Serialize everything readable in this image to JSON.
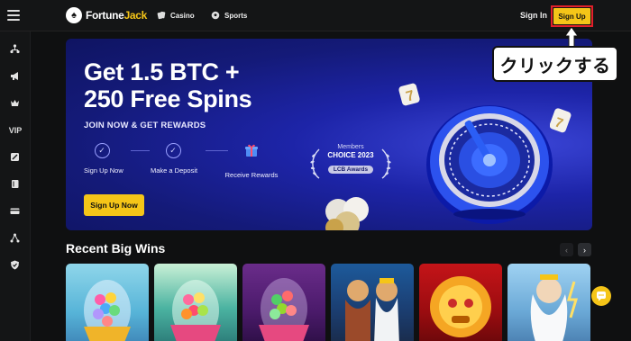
{
  "header": {
    "logo_text_a": "Fortune",
    "logo_text_b": "Jack",
    "nav": [
      {
        "label": "Casino",
        "icon": "cards-icon"
      },
      {
        "label": "Sports",
        "icon": "soccer-ball-icon"
      }
    ],
    "signin_label": "Sign In",
    "signup_label": "Sign Up"
  },
  "sidebar": {
    "items": [
      {
        "icon": "tournament-bracket-icon"
      },
      {
        "icon": "megaphone-icon"
      },
      {
        "icon": "crown-icon"
      },
      {
        "icon": "vip-icon",
        "label": "VIP"
      },
      {
        "icon": "ticket-icon"
      },
      {
        "icon": "book-icon"
      },
      {
        "icon": "card-icon"
      },
      {
        "icon": "network-icon"
      },
      {
        "icon": "shield-icon"
      }
    ]
  },
  "hero": {
    "title_line1": "Get 1.5 BTC +",
    "title_line2": "250 Free Spins",
    "subtitle": "JOIN NOW & GET REWARDS",
    "steps": [
      {
        "label": "Sign Up Now"
      },
      {
        "label": "Make a Deposit"
      },
      {
        "label": "Receive Rewards"
      }
    ],
    "cta_label": "Sign Up Now",
    "award": {
      "top": "Members",
      "main": "CHOICE 2023",
      "tag": "LCB Awards"
    }
  },
  "annotation": {
    "callout_text": "クリックする",
    "highlight_color": "#e2202a"
  },
  "recent_wins": {
    "title": "Recent Big Wins",
    "prev_label": "‹",
    "next_label": "›",
    "games": [
      {
        "name": "egg-rocket-game-1"
      },
      {
        "name": "egg-rocket-game-2"
      },
      {
        "name": "egg-rocket-game-3"
      },
      {
        "name": "zeus-game-1"
      },
      {
        "name": "lion-mask-game"
      },
      {
        "name": "zeus-game-2"
      }
    ]
  },
  "colors": {
    "accent": "#f5c518",
    "hero_bg": "#1d24a8",
    "page_bg": "#0f1011"
  }
}
